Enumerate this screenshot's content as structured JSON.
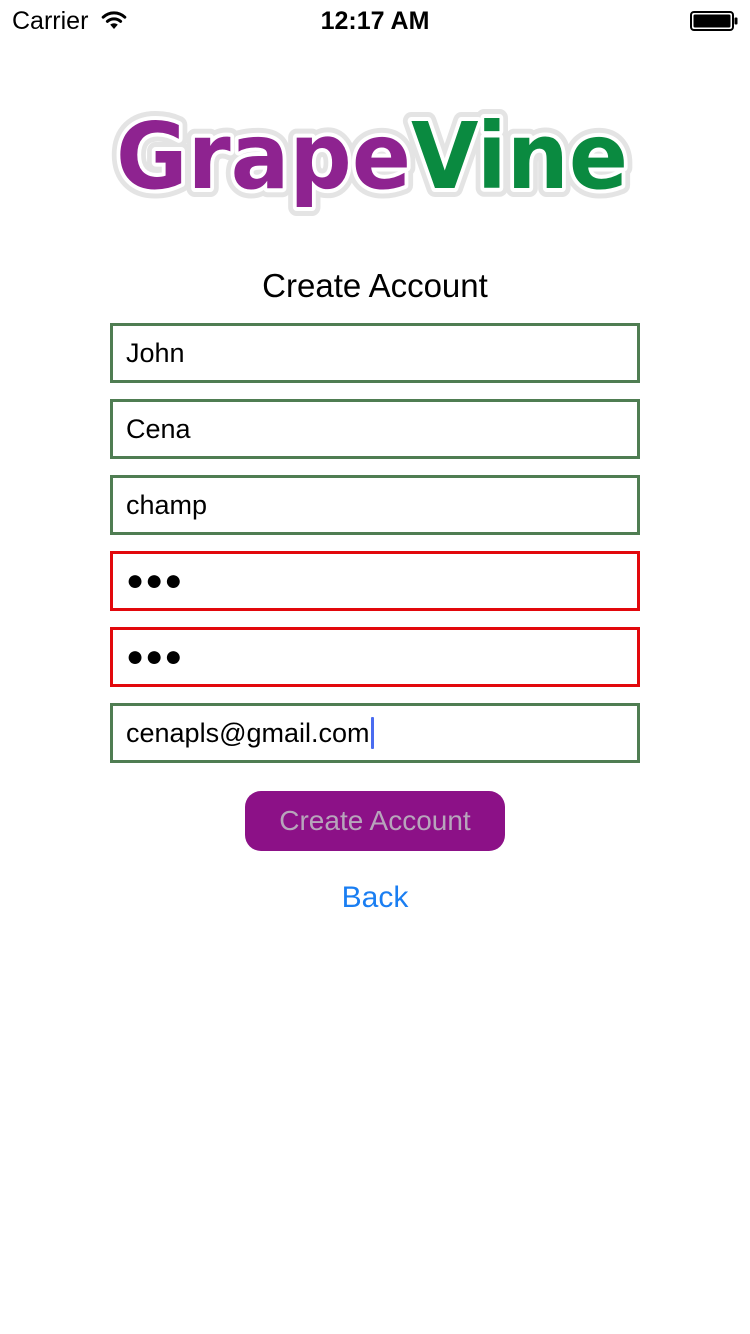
{
  "status_bar": {
    "carrier": "Carrier",
    "time": "12:17 AM",
    "wifi_icon": "wifi-icon",
    "battery_icon": "battery-full-icon"
  },
  "logo": {
    "part1": "Grape",
    "part2": "Vine",
    "part1_color": "#8e2390",
    "part2_color": "#0a8a40"
  },
  "title": "Create Account",
  "form": {
    "fields": [
      {
        "value": "John",
        "valid": true
      },
      {
        "value": "Cena",
        "valid": true
      },
      {
        "value": "champ",
        "valid": true
      },
      {
        "value": "●●●",
        "valid": false
      },
      {
        "value": "●●●",
        "valid": false
      },
      {
        "value": "cenapls@gmail.com",
        "valid": true
      }
    ],
    "valid_border_color": "#4f7d52",
    "invalid_border_color": "#e2080c"
  },
  "create_button_label": "Create Account",
  "back_label": "Back"
}
